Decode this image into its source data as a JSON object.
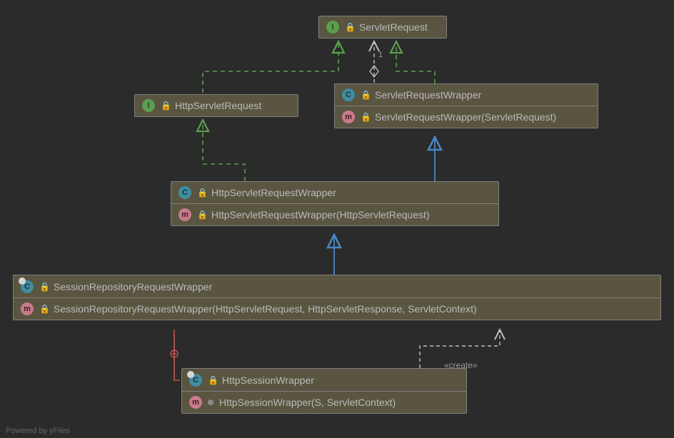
{
  "footer": "Powered by yFiles",
  "createLabel": "«create»",
  "nodes": {
    "servletRequest": {
      "title": "ServletRequest"
    },
    "httpServletRequest": {
      "title": "HttpServletRequest"
    },
    "servletRequestWrapper": {
      "title": "ServletRequestWrapper",
      "ctor": "ServletRequestWrapper(ServletRequest)"
    },
    "httpServletRequestWrapper": {
      "title": "HttpServletRequestWrapper",
      "ctor": "HttpServletRequestWrapper(HttpServletRequest)"
    },
    "sessionRepositoryRequestWrapper": {
      "title": "SessionRepositoryRequestWrapper",
      "ctor": "SessionRepositoryRequestWrapper(HttpServletRequest, HttpServletResponse, ServletContext)"
    },
    "httpSessionWrapper": {
      "title": "HttpSessionWrapper",
      "ctor": "HttpSessionWrapper(S, ServletContext)"
    }
  }
}
